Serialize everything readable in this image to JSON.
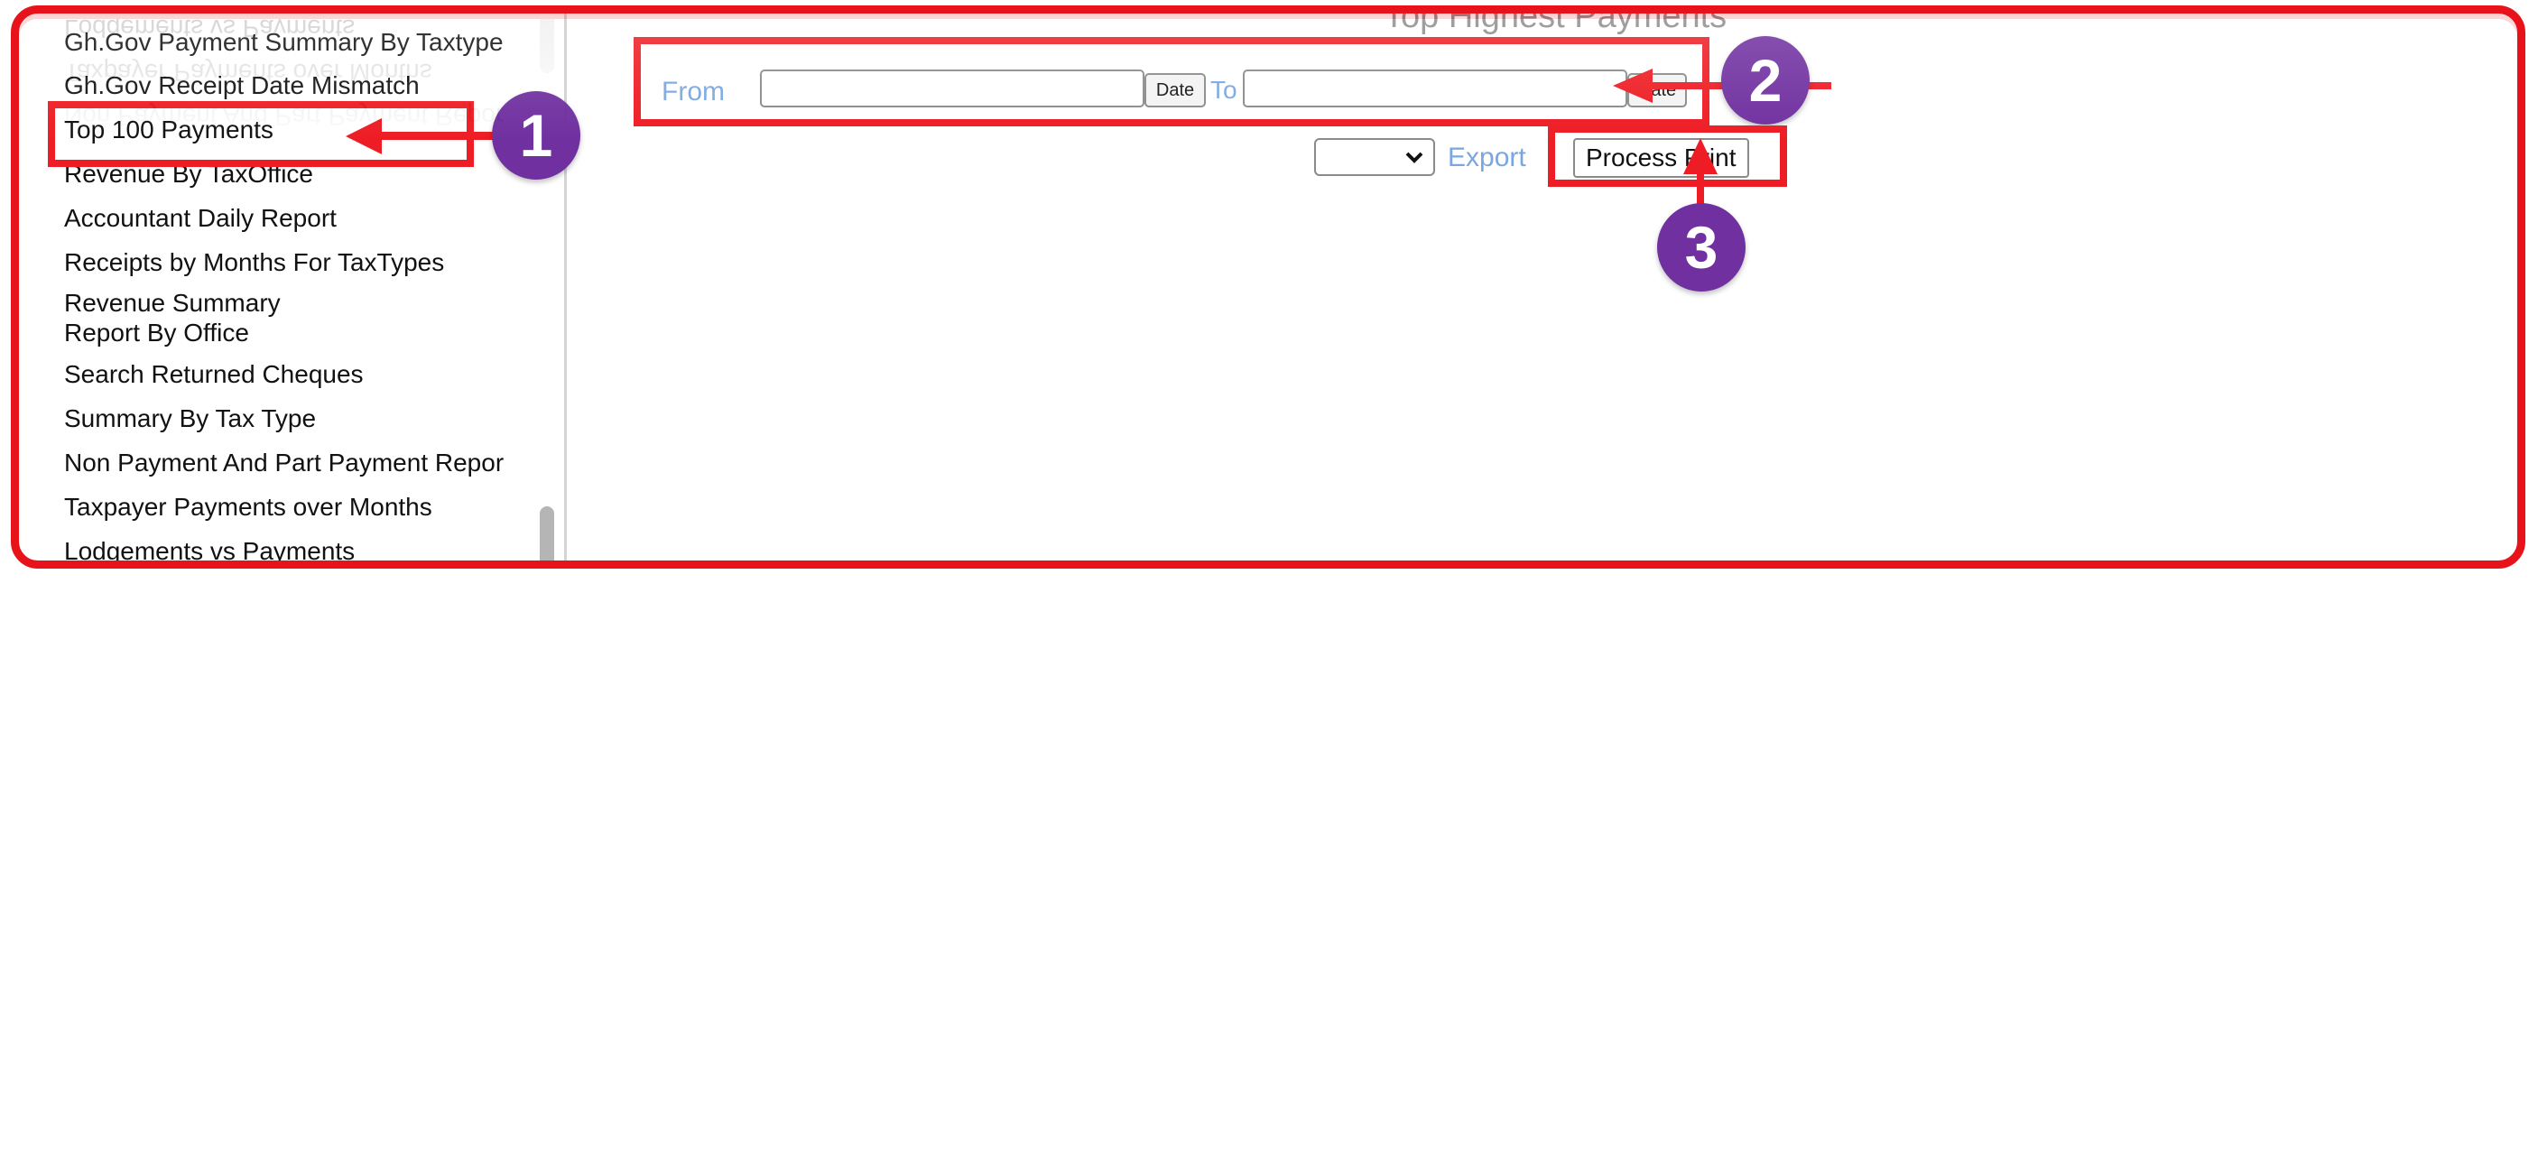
{
  "page": {
    "heading": "Top Highest Payments"
  },
  "sidebar": {
    "items": [
      {
        "label": "Gh.Gov Payment Summary By Taxtype"
      },
      {
        "label": "Gh.Gov Receipt Date Mismatch"
      },
      {
        "label": "Top 100 Payments"
      },
      {
        "label": "Revenue By TaxOffice"
      },
      {
        "label": "Accountant Daily Report"
      },
      {
        "label": "Receipts by Months For TaxTypes"
      },
      {
        "label": "Revenue Summary Report By Office"
      },
      {
        "label": "Search Returned Cheques"
      },
      {
        "label": "Summary By Tax Type"
      },
      {
        "label": "Non Payment And Part Payment Repor"
      },
      {
        "label": "Taxpayer Payments over Months"
      },
      {
        "label": "Lodgements vs Payments"
      }
    ]
  },
  "filters": {
    "from_label": "From",
    "from_value": "",
    "from_date_button": "Date",
    "to_label": "To",
    "to_value": "",
    "to_date_button": "Date"
  },
  "actions": {
    "export_format_selected": "",
    "export_label": "Export",
    "process_print_label": "Process Print"
  },
  "annotations": {
    "step1": "1",
    "step2": "2",
    "step3": "3"
  },
  "colors": {
    "highlight": "#ee1c24",
    "badge": "#7030a0",
    "link": "#7aa7e0",
    "heading": "#8c8c8c"
  }
}
